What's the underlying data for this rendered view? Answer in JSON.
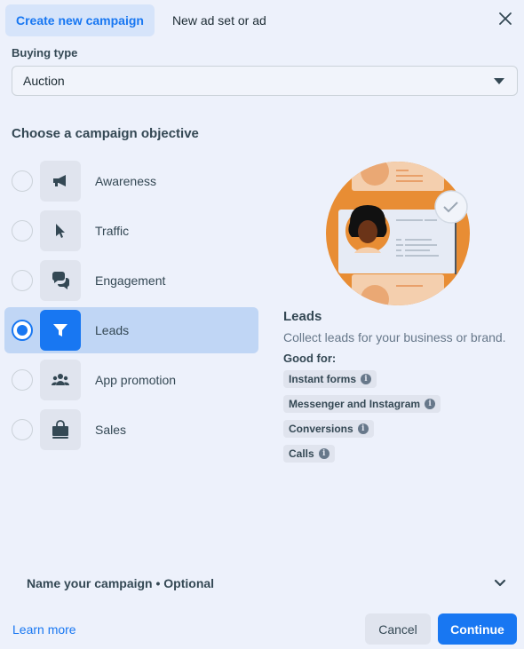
{
  "tabs": [
    {
      "label": "Create new campaign",
      "active": true
    },
    {
      "label": "New ad set or ad",
      "active": false
    }
  ],
  "buying_type": {
    "label": "Buying type",
    "value": "Auction"
  },
  "objective_section": {
    "title": "Choose a campaign objective",
    "selected": "Leads",
    "items": [
      {
        "label": "Awareness",
        "icon": "megaphone-icon"
      },
      {
        "label": "Traffic",
        "icon": "cursor-icon"
      },
      {
        "label": "Engagement",
        "icon": "chat-bubbles-icon"
      },
      {
        "label": "Leads",
        "icon": "funnel-icon"
      },
      {
        "label": "App promotion",
        "icon": "people-icon"
      },
      {
        "label": "Sales",
        "icon": "shopping-bag-icon"
      }
    ]
  },
  "detail": {
    "title": "Leads",
    "description": "Collect leads for your business or brand.",
    "good_for_label": "Good for:",
    "chips": [
      "Instant forms",
      "Messenger and Instagram",
      "Conversions",
      "Calls"
    ]
  },
  "name_campaign": {
    "label": "Name your campaign • Optional"
  },
  "footer": {
    "learn_more": "Learn more",
    "cancel": "Cancel",
    "continue": "Continue"
  },
  "colors": {
    "accent": "#1877f2",
    "background": "#edf1fb",
    "selected_row": "#c0d6f5",
    "illustration_orange": "#e88d34"
  }
}
